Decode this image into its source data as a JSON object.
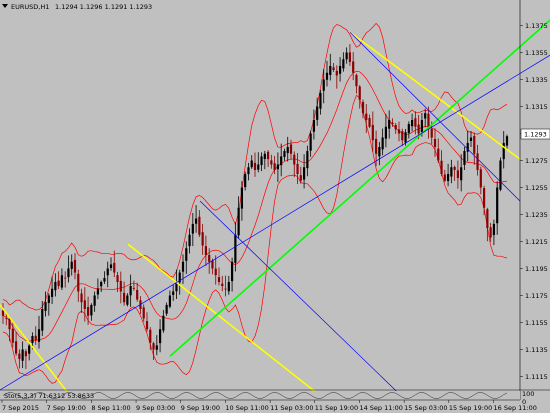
{
  "header": {
    "symbol": "EURUSD,H1",
    "ohlc": "1.1294 1.1296 1.1291 1.1293"
  },
  "indicator_label": "Sto(5,3,3) 71.6312 53.8633",
  "current_price_badge": "1.1293",
  "colors": {
    "background": "#c0c0c0",
    "bull_candle": "#000000",
    "bear_candle": "#8b0000",
    "bollinger": "#ff0000",
    "trend_yellow": "#ffff00",
    "trend_green": "#00ff00",
    "trend_blue": "#0000ff"
  },
  "chart_data": {
    "type": "candlestick",
    "y_ticks": [
      "1.1375",
      "1.1355",
      "1.1335",
      "1.1315",
      "1.1295",
      "1.1275",
      "1.1255",
      "1.1235",
      "1.1215",
      "1.1195",
      "1.1175",
      "1.1155",
      "1.1135",
      "1.1115"
    ],
    "x_ticks": [
      "7 Sep 2015",
      "7 Sep 19:00",
      "8 Sep 11:00",
      "9 Sep 03:00",
      "9 Sep 19:00",
      "10 Sep 11:00",
      "11 Sep 03:00",
      "11 Sep 19:00",
      "14 Sep 11:00",
      "15 Sep 03:00",
      "15 Sep 19:00",
      "16 Sep 11:00"
    ],
    "ylim": [
      1.1105,
      1.1385
    ],
    "indicator_ticks": [
      "100",
      "0"
    ],
    "close_path": [
      1.116,
      1.1158,
      1.115,
      1.114,
      1.1132,
      1.1128,
      1.1135,
      1.113,
      1.1138,
      1.1145,
      1.1142,
      1.115,
      1.1165,
      1.117,
      1.1175,
      1.118,
      1.1185,
      1.1182,
      1.119,
      1.1188,
      1.1195,
      1.12,
      1.1192,
      1.1178,
      1.117,
      1.1165,
      1.116,
      1.1168,
      1.1175,
      1.118,
      1.1185,
      1.1188,
      1.1195,
      1.1198,
      1.1192,
      1.1185,
      1.1178,
      1.117,
      1.1175,
      1.1182,
      1.118,
      1.1172,
      1.1165,
      1.1158,
      1.115,
      1.114,
      1.1135,
      1.1138,
      1.115,
      1.116,
      1.1168,
      1.1175,
      1.1178,
      1.1185,
      1.1192,
      1.12,
      1.121,
      1.122,
      1.1228,
      1.1232,
      1.122,
      1.1212,
      1.1205,
      1.12,
      1.1195,
      1.119,
      1.1185,
      1.1182,
      1.118,
      1.1185,
      1.12,
      1.122,
      1.124,
      1.1255,
      1.1265,
      1.127,
      1.1275,
      1.1268,
      1.1272,
      1.1278,
      1.128,
      1.1276,
      1.1272,
      1.1268,
      1.1272,
      1.1278,
      1.1282,
      1.1285,
      1.128,
      1.1272,
      1.1265,
      1.126,
      1.127,
      1.1282,
      1.1295,
      1.1305,
      1.1315,
      1.1325,
      1.1335,
      1.134,
      1.1345,
      1.1342,
      1.1338,
      1.1345,
      1.135,
      1.1355,
      1.1348,
      1.134,
      1.133,
      1.132,
      1.131,
      1.1305,
      1.13,
      1.129,
      1.128,
      1.1285,
      1.1292,
      1.13,
      1.1305,
      1.1302,
      1.1298,
      1.1295,
      1.129,
      1.1296,
      1.1302,
      1.1305,
      1.13,
      1.1295,
      1.1305,
      1.131,
      1.13,
      1.1292,
      1.1285,
      1.1275,
      1.1265,
      1.126,
      1.1265,
      1.127,
      1.1268,
      1.1262,
      1.127,
      1.1282,
      1.1288,
      1.1292,
      1.128,
      1.1268,
      1.1255,
      1.124,
      1.1225,
      1.1218,
      1.1228,
      1.1255,
      1.1275,
      1.1288,
      1.1293
    ],
    "series": [
      {
        "name": "trend-yellow-1",
        "points": [
          [
            0,
            1.1168
          ],
          [
            73,
            1.1098
          ]
        ]
      },
      {
        "name": "trend-yellow-2",
        "points": [
          [
            128,
            1.1213
          ],
          [
            325,
            1.1098
          ]
        ]
      },
      {
        "name": "trend-yellow-3",
        "points": [
          [
            350,
            1.137
          ],
          [
            520,
            1.1276
          ]
        ]
      },
      {
        "name": "trend-green",
        "points": [
          [
            170,
            1.113
          ],
          [
            550,
            1.1379
          ]
        ]
      },
      {
        "name": "trend-blue-1",
        "points": [
          [
            0,
            1.1105
          ],
          [
            550,
            1.1353
          ]
        ]
      },
      {
        "name": "trend-blue-2",
        "points": [
          [
            200,
            1.1245
          ],
          [
            405,
            1.1098
          ]
        ]
      },
      {
        "name": "trend-blue-3",
        "points": [
          [
            350,
            1.137
          ],
          [
            520,
            1.1245
          ]
        ]
      }
    ]
  }
}
